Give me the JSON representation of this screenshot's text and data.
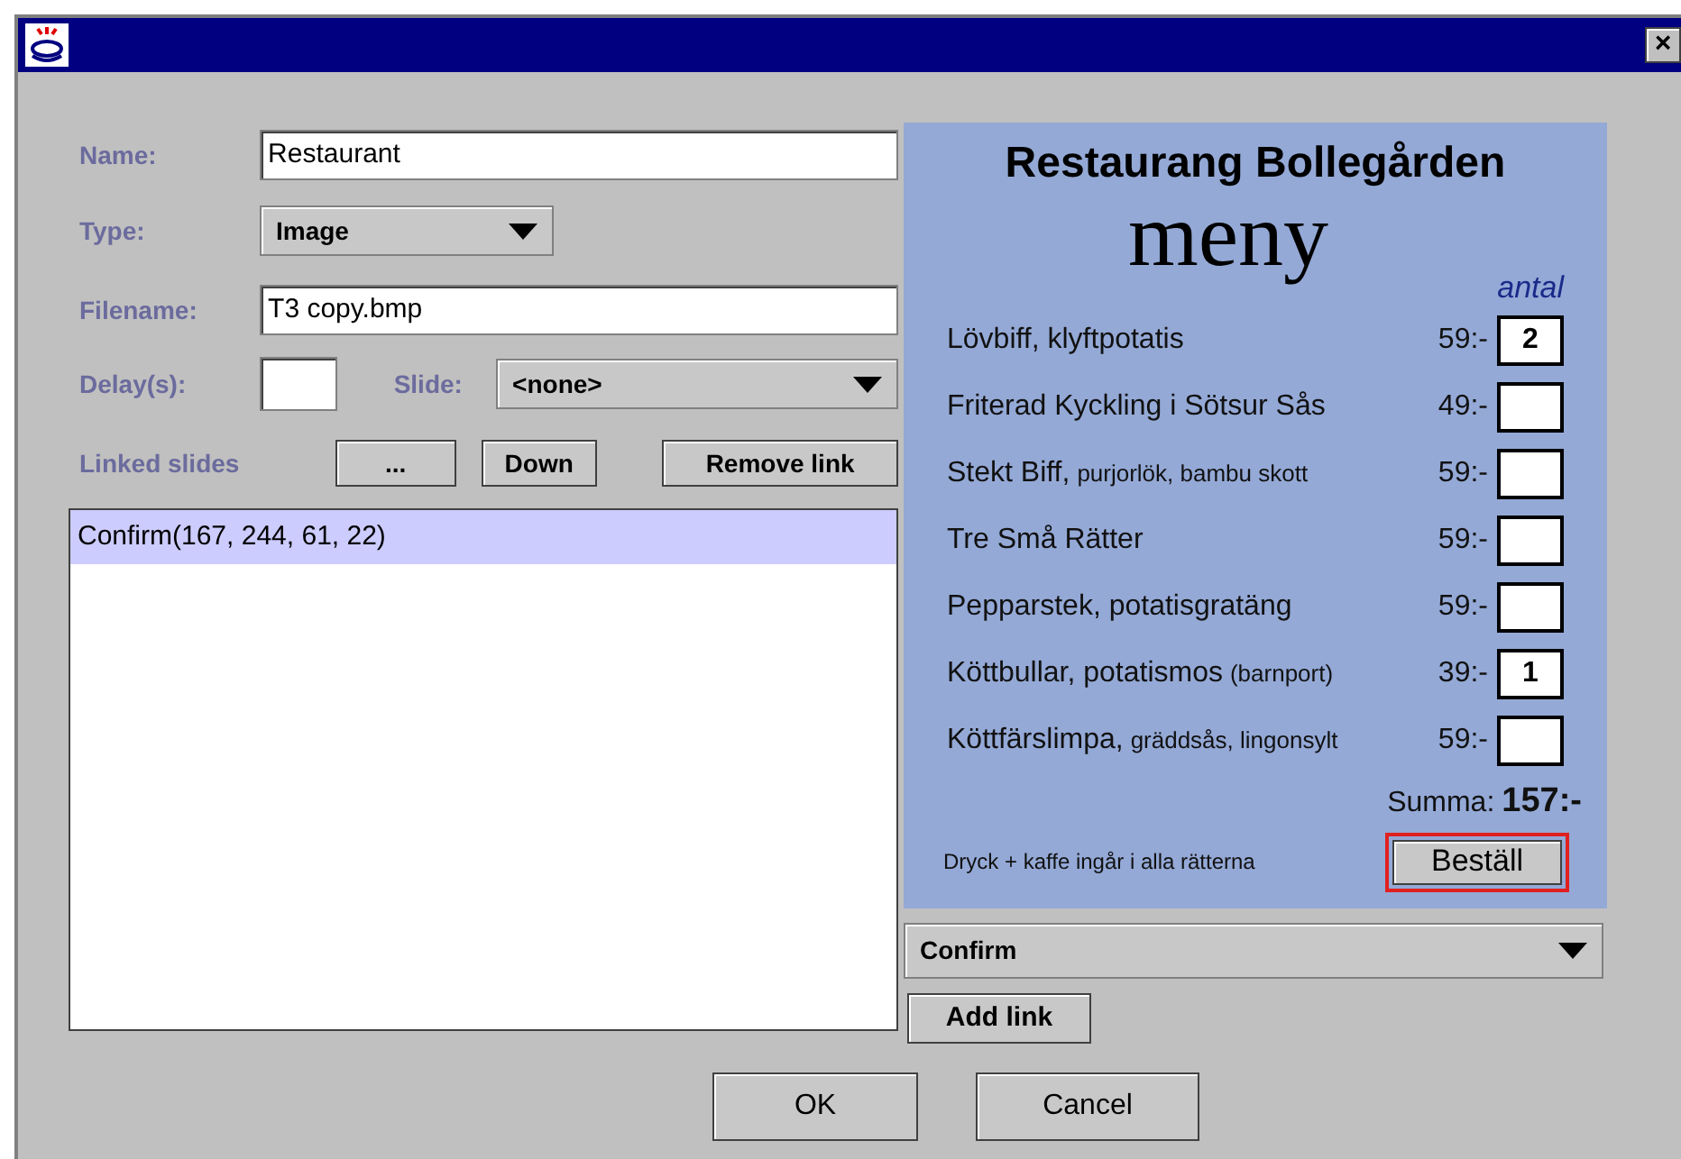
{
  "window": {
    "close": "×"
  },
  "form": {
    "name_label": "Name:",
    "name_value": "Restaurant",
    "type_label": "Type:",
    "type_value": "Image",
    "filename_label": "Filename:",
    "filename_value": "T3 copy.bmp",
    "delay_label": "Delay(s):",
    "slide_label": "Slide:",
    "slide_value": "<none>"
  },
  "linked": {
    "label": "Linked slides",
    "buttons": [
      "...",
      "Down",
      "Remove link"
    ],
    "items": [
      {
        "text": "Confirm(167, 244, 61, 22)",
        "selected": true
      }
    ]
  },
  "preview": {
    "title": "Restaurang Bollegården",
    "subtitle": "meny",
    "qty_header": "antal",
    "items": [
      {
        "name": "Lövbiff, klyftpotatis",
        "price": "59:-",
        "qty": "2"
      },
      {
        "name": "Friterad Kyckling i Sötsur Sås",
        "price": "49:-"
      },
      {
        "name": "Stekt Biff,",
        "detail": "purjorlök, bambu skott",
        "price": "59:-"
      },
      {
        "name": "Tre Små Rätter",
        "price": "59:-"
      },
      {
        "name": "Pepparstek, potatisgratäng",
        "price": "59:-"
      },
      {
        "name": "Köttbullar, potatismos",
        "detail": "(barnport)",
        "price": "39:-",
        "qty": "1"
      },
      {
        "name": "Köttfärslimpa,",
        "detail": "gräddsås, lingonsylt",
        "price": "59:-"
      }
    ],
    "total_label": "Summa:",
    "total": "157:-",
    "note": "Dryck + kaffe ingår i alla rätterna",
    "order_button": "Beställ",
    "order_highlighted": true
  },
  "link_target": "Confirm",
  "add_link": "Add link",
  "buttons": [
    "OK",
    "Cancel"
  ]
}
